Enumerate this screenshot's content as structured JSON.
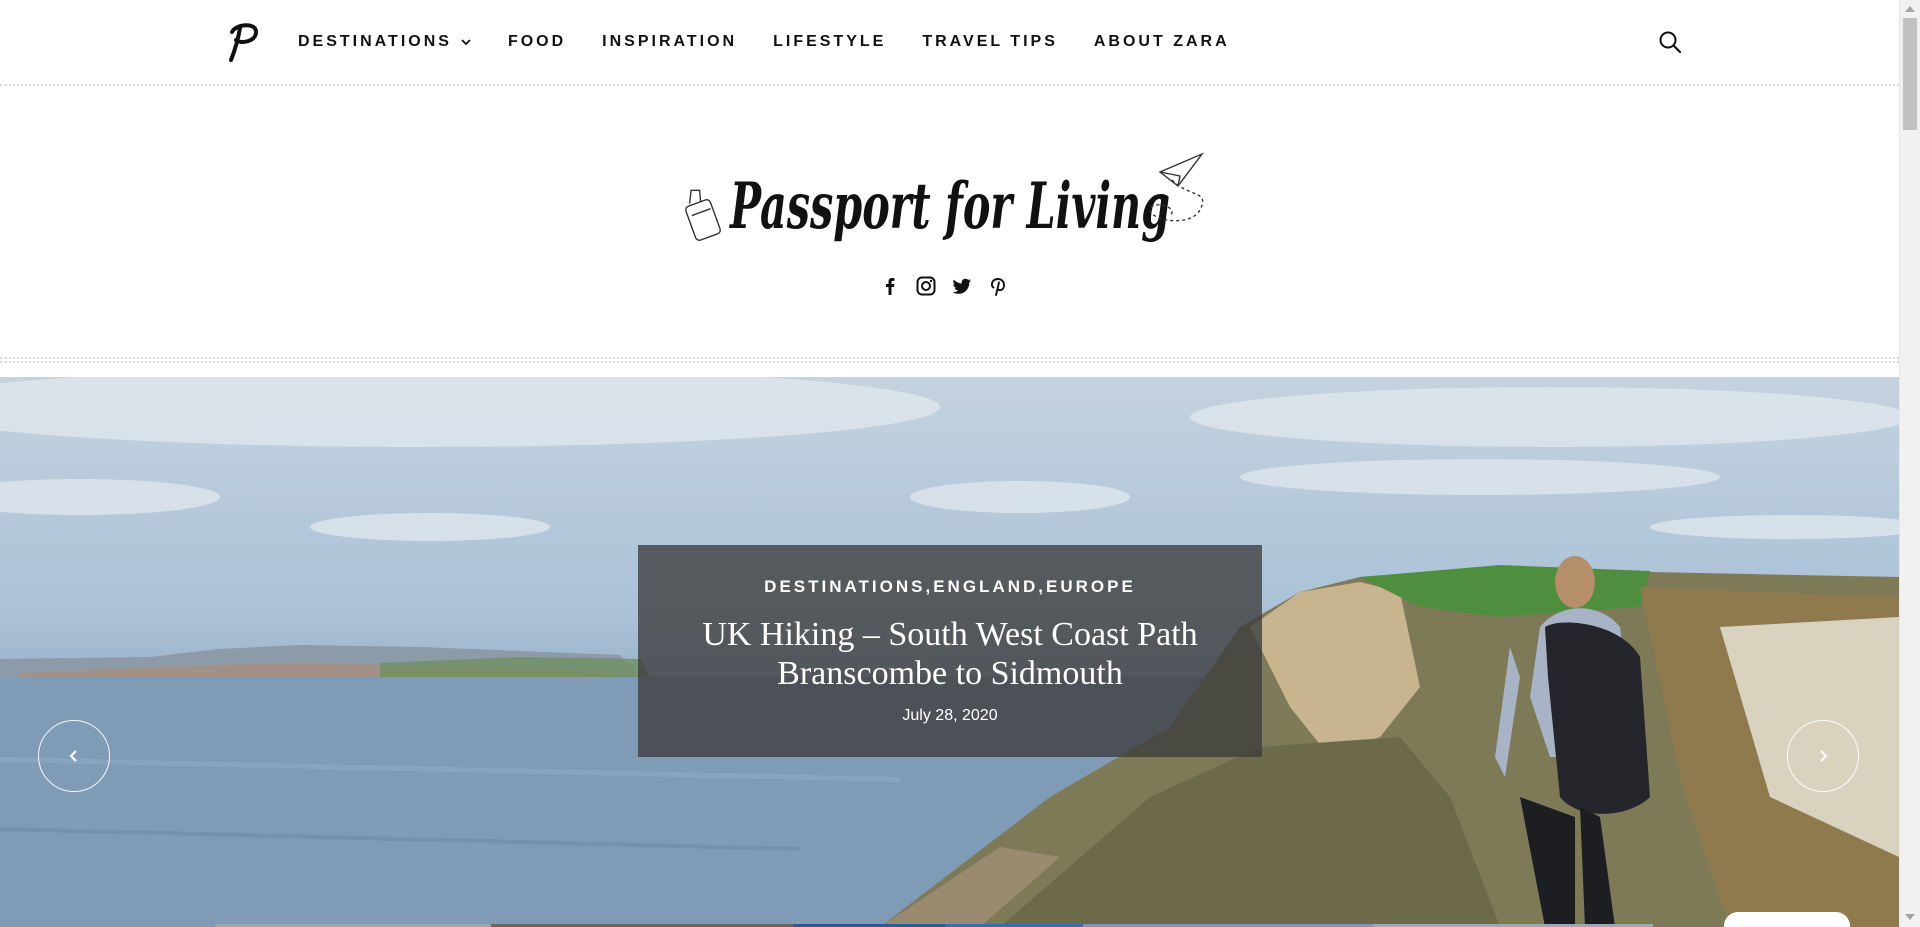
{
  "nav": {
    "items": [
      {
        "label": "DESTINATIONS",
        "has_dropdown": true
      },
      {
        "label": "FOOD"
      },
      {
        "label": "INSPIRATION"
      },
      {
        "label": "LIFESTYLE"
      },
      {
        "label": "TRAVEL TIPS"
      },
      {
        "label": "ABOUT ZARA"
      }
    ],
    "logo_icon": "p-monogram-icon",
    "search_icon": "search-icon"
  },
  "brand": {
    "site_name": "Passport for Living",
    "decoration_icons": [
      "suitcase-icon",
      "paper-plane-icon"
    ],
    "social": [
      "facebook-icon",
      "instagram-icon",
      "twitter-icon",
      "pinterest-icon"
    ]
  },
  "hero": {
    "categories": [
      "DESTINATIONS",
      "ENGLAND",
      "EUROPE"
    ],
    "category_separator": ",",
    "title": "UK Hiking – South West Coast Path Branscombe to Sidmouth",
    "date": "July 28, 2020",
    "prev_icon": "chevron-left-icon",
    "next_icon": "chevron-right-icon"
  },
  "colors": {
    "text": "#111111",
    "caption_bg": "#3c3c3c",
    "divider": "#d8d8d8",
    "white": "#ffffff"
  }
}
